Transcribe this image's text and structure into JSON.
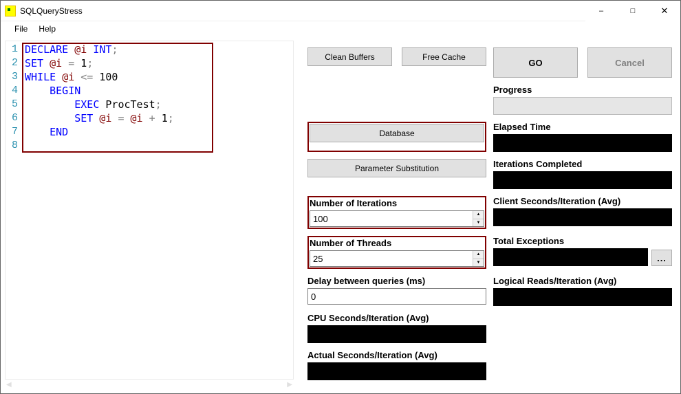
{
  "window": {
    "title": "SQLQueryStress"
  },
  "menu": {
    "file": "File",
    "help": "Help"
  },
  "editor": {
    "lines": [
      1,
      2,
      3,
      4,
      5,
      6,
      7,
      8
    ],
    "code_tokens": [
      [
        {
          "t": "DECLARE",
          "c": "kw"
        },
        {
          "t": " "
        },
        {
          "t": "@i",
          "c": "var"
        },
        {
          "t": " "
        },
        {
          "t": "INT",
          "c": "kw"
        },
        {
          "t": ";",
          "c": "op"
        }
      ],
      [
        {
          "t": "SET",
          "c": "kw"
        },
        {
          "t": " "
        },
        {
          "t": "@i",
          "c": "var"
        },
        {
          "t": " "
        },
        {
          "t": "=",
          "c": "op"
        },
        {
          "t": " "
        },
        {
          "t": "1",
          "c": "num"
        },
        {
          "t": ";",
          "c": "op"
        }
      ],
      [
        {
          "t": "WHILE",
          "c": "kw"
        },
        {
          "t": " "
        },
        {
          "t": "@i",
          "c": "var"
        },
        {
          "t": " "
        },
        {
          "t": "<=",
          "c": "op"
        },
        {
          "t": " "
        },
        {
          "t": "100",
          "c": "num"
        }
      ],
      [
        {
          "t": "    "
        },
        {
          "t": "BEGIN",
          "c": "kw"
        }
      ],
      [
        {
          "t": "        "
        },
        {
          "t": "EXEC",
          "c": "kw"
        },
        {
          "t": " ProcTest"
        },
        {
          "t": ";",
          "c": "op"
        }
      ],
      [
        {
          "t": "        "
        },
        {
          "t": "SET",
          "c": "kw"
        },
        {
          "t": " "
        },
        {
          "t": "@i",
          "c": "var"
        },
        {
          "t": " "
        },
        {
          "t": "=",
          "c": "op"
        },
        {
          "t": " "
        },
        {
          "t": "@i",
          "c": "var"
        },
        {
          "t": " "
        },
        {
          "t": "+",
          "c": "op"
        },
        {
          "t": " "
        },
        {
          "t": "1",
          "c": "num"
        },
        {
          "t": ";",
          "c": "op"
        }
      ],
      [
        {
          "t": "    "
        },
        {
          "t": "END",
          "c": "kw"
        }
      ],
      []
    ]
  },
  "buttons": {
    "clean_buffers": "Clean Buffers",
    "free_cache": "Free Cache",
    "go": "GO",
    "cancel": "Cancel",
    "database": "Database",
    "param_sub": "Parameter Substitution",
    "ellipsis": "..."
  },
  "labels": {
    "progress": "Progress",
    "elapsed": "Elapsed Time",
    "iter_label": "Number of Iterations",
    "iter_completed": "Iterations Completed",
    "threads_label": "Number of Threads",
    "client_sec": "Client Seconds/Iteration (Avg)",
    "delay_label": "Delay between queries (ms)",
    "total_exc": "Total Exceptions",
    "cpu_sec": "CPU Seconds/Iteration (Avg)",
    "logical_reads": "Logical Reads/Iteration (Avg)",
    "actual_sec": "Actual Seconds/Iteration (Avg)"
  },
  "values": {
    "iterations": "100",
    "threads": "25",
    "delay": "0"
  }
}
